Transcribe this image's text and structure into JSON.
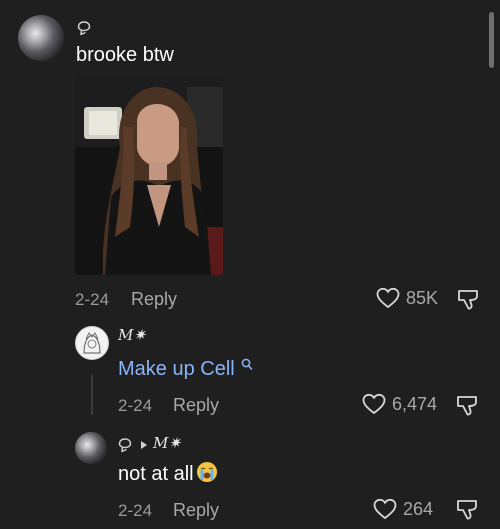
{
  "comments": [
    {
      "text": "brooke btw",
      "date": "2-24",
      "reply_label": "Reply",
      "like_count": "85K",
      "has_image": true
    },
    {
      "username": "M✷",
      "link_text": "Make up Cell",
      "date": "2-24",
      "reply_label": "Reply",
      "like_count": "6,474"
    },
    {
      "username": "M✷",
      "text": "not at all",
      "date": "2-24",
      "reply_label": "Reply",
      "like_count": "264"
    }
  ],
  "icons": {
    "badge": "gem-outline-icon",
    "like": "heart-outline-icon",
    "dislike": "thumbs-down-outline-icon",
    "search": "search-icon",
    "arrow": "play-arrow-icon",
    "emoji": "loudly-crying-face-emoji"
  },
  "colors": {
    "background": "#1f1f1f",
    "link": "#8ab4f8",
    "muted_text": "#a8a8a8"
  }
}
